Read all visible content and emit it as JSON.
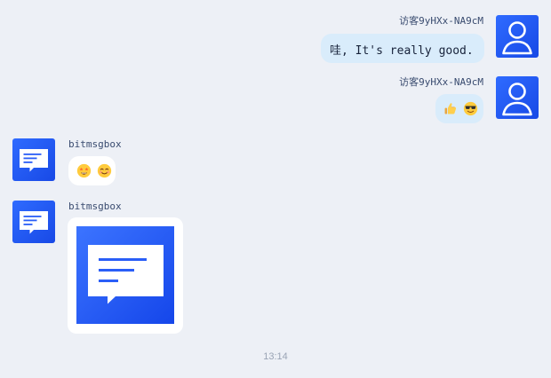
{
  "messages": [
    {
      "side": "right",
      "sender": "访客9yHXx-NA9cM",
      "text": "哇, It's really good."
    },
    {
      "side": "right",
      "sender": "访客9yHXx-NA9cM",
      "emojis": [
        "thumbs-up",
        "smiling-face-with-sunglasses"
      ]
    },
    {
      "side": "left",
      "sender": "bitmsgbox",
      "emojis": [
        "star-struck",
        "smiling-face"
      ]
    },
    {
      "side": "left",
      "sender": "bitmsgbox",
      "image": "message-icon-image"
    }
  ],
  "time": "13:14",
  "colors": {
    "background": "#edf0f6",
    "outgoing_bubble": "#d9ecfb",
    "incoming_bubble": "#ffffff",
    "avatar": "#1f58f5",
    "sender_text": "#394b6f",
    "timestamp_text": "#9aa4b5"
  }
}
